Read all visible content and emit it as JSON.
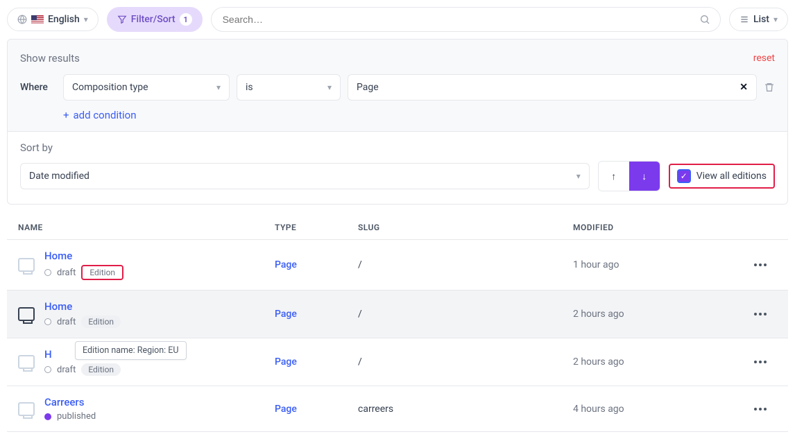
{
  "toolbar": {
    "lang_label": "English",
    "filter_label": "Filter/Sort",
    "filter_count": "1",
    "search_placeholder": "Search…",
    "view_label": "List"
  },
  "filter": {
    "show_results": "Show results",
    "reset": "reset",
    "where_label": "Where",
    "field": "Composition type",
    "operator": "is",
    "value": "Page",
    "add_condition": "add condition",
    "sort_by_label": "Sort by",
    "sort_field": "Date modified",
    "view_all_label": "View all editions"
  },
  "columns": {
    "name": "NAME",
    "type": "TYPE",
    "slug": "SLUG",
    "modified": "MODIFIED"
  },
  "rows": [
    {
      "title": "Home",
      "status": "draft",
      "status_text": "draft",
      "edition_chip": "Edition",
      "type": "Page",
      "slug": "/",
      "modified": "1 hour ago",
      "chip_outlined": true,
      "active": false
    },
    {
      "title": "Home",
      "status": "draft",
      "status_text": "draft",
      "edition_chip": "Edition",
      "type": "Page",
      "slug": "/",
      "modified": "2 hours ago",
      "chip_outlined": false,
      "active": true
    },
    {
      "title": "H",
      "status": "draft",
      "status_text": "draft",
      "edition_chip": "Edition",
      "type": "Page",
      "slug": "/",
      "modified": "2 hours ago",
      "chip_outlined": false,
      "active": false,
      "tooltip": "Edition name: Region: EU"
    },
    {
      "title": "Carreers",
      "status": "published",
      "status_text": "published",
      "edition_chip": "",
      "type": "Page",
      "slug": "carreers",
      "modified": "4 hours ago",
      "chip_outlined": false,
      "active": false
    }
  ]
}
